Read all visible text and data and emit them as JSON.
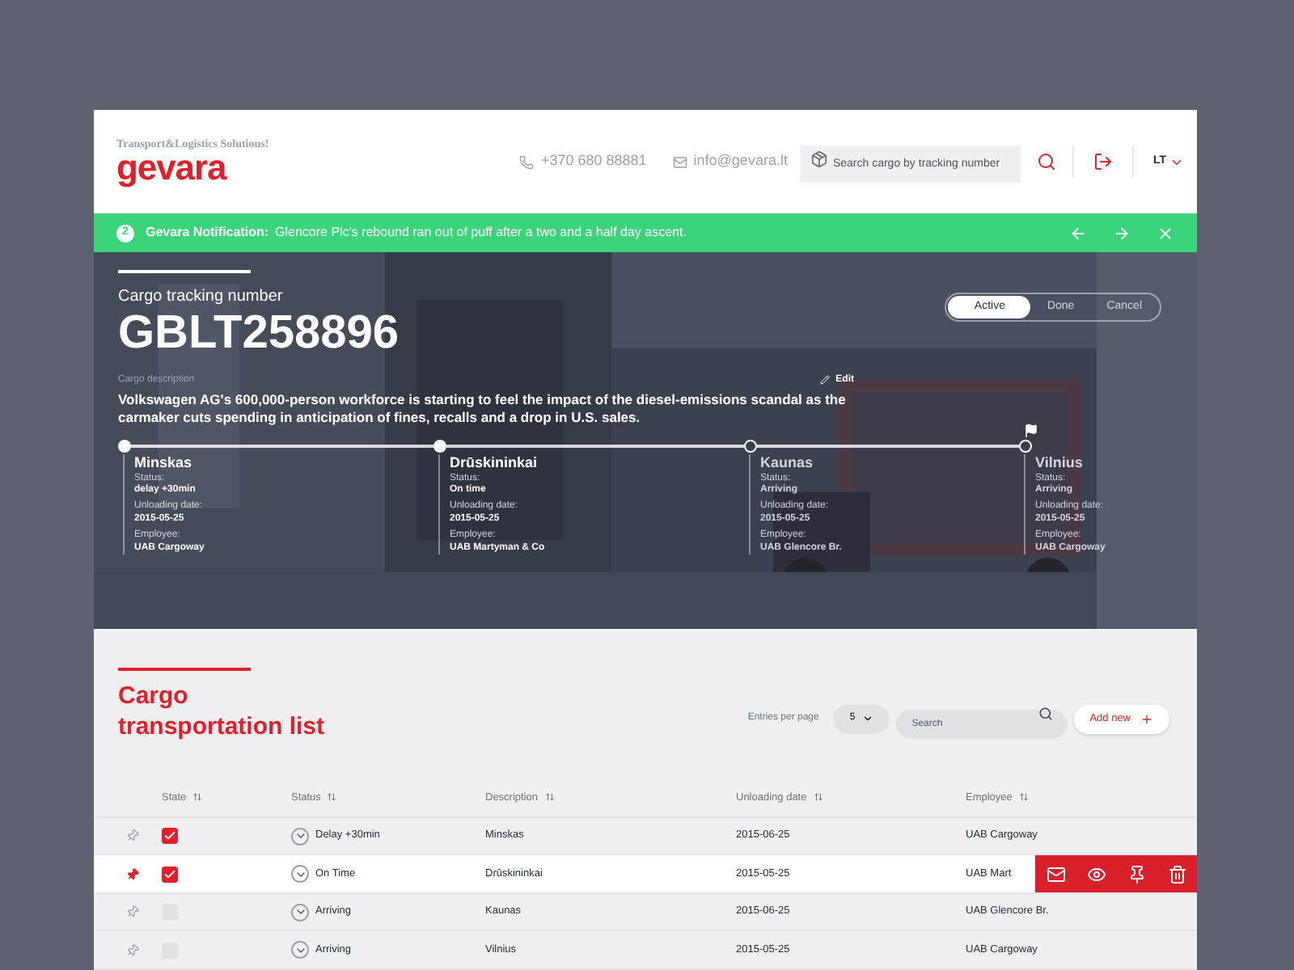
{
  "header": {
    "logo": {
      "tagline": "Transport&Logistics Solutions!",
      "name": "gevara"
    },
    "phone": "+370 680 88881",
    "email": "info@gevara.lt",
    "search": {
      "placeholder": "Search cargo by tracking number"
    },
    "language": "LT"
  },
  "notification": {
    "count": "2",
    "title": "Gevara Notification:",
    "message": "Glencore Plc's rebound ran out of puff after a two and a half day ascent."
  },
  "hero": {
    "label": "Cargo tracking number",
    "tracking_number": "GBLT258896",
    "filters": [
      {
        "label": "Active",
        "selected": true
      },
      {
        "label": "Done",
        "selected": false
      },
      {
        "label": "Cancel",
        "selected": false
      }
    ],
    "description_label": "Cargo description",
    "edit": "Edit",
    "description": "Volkswagen AG's 600,000-person workforce is starting to feel the impact of the diesel-emissions scandal as the carmaker cuts spending in anticipation of fines, recalls and a drop in U.S. sales.",
    "stops": [
      {
        "city": "Minskas",
        "reached": true,
        "flag": false,
        "status_label": "Status:",
        "status": "delay +30min",
        "date_label": "Unloading date:",
        "date": "2015-05-25",
        "employee_label": "Employee:",
        "employee": "UAB Cargoway"
      },
      {
        "city": "Drūskininkai",
        "reached": true,
        "flag": false,
        "status_label": "Status:",
        "status": "On time",
        "date_label": "Unloading date:",
        "date": "2015-05-25",
        "employee_label": "Employee:",
        "employee": "UAB Martyman & Co"
      },
      {
        "city": "Kaunas",
        "reached": false,
        "flag": false,
        "status_label": "Status:",
        "status": "Arriving",
        "date_label": "Unloading date:",
        "date": "2015-05-25",
        "employee_label": "Employee:",
        "employee": "UAB Glencore Br."
      },
      {
        "city": "Vilnius",
        "reached": false,
        "flag": true,
        "status_label": "Status:",
        "status": "Arriving",
        "date_label": "Unloading date:",
        "date": "2015-05-25",
        "employee_label": "Employee:",
        "employee": "UAB Cargoway"
      }
    ]
  },
  "list": {
    "title_line_1": "Cargo",
    "title_line_2": "transportation list",
    "entries_label": "Entries per page",
    "entries_value": "5",
    "search": {
      "placeholder": "Search"
    },
    "add_button": "Add new",
    "columns": [
      "State",
      "Status",
      "Description",
      "Unloading date",
      "Employee"
    ],
    "rows": [
      {
        "pinned": false,
        "checked": true,
        "selected": false,
        "status": "Delay +30min",
        "description": "Minskas",
        "date": "2015-06-25",
        "employee": "UAB Cargoway",
        "actions": false
      },
      {
        "pinned": true,
        "checked": true,
        "selected": true,
        "status": "On Time",
        "description": "Drūskininkai",
        "date": "2015-05-25",
        "employee": "UAB Mart",
        "actions": true
      },
      {
        "pinned": false,
        "checked": false,
        "selected": false,
        "status": "Arriving",
        "description": "Kaunas",
        "date": "2015-06-25",
        "employee": "UAB Glencore Br.",
        "actions": false
      },
      {
        "pinned": false,
        "checked": false,
        "selected": false,
        "status": "Arriving",
        "description": "Vilnius",
        "date": "2015-05-25",
        "employee": "UAB Cargoway",
        "actions": false
      }
    ],
    "row_actions": [
      {
        "kind": "mail"
      },
      {
        "kind": "view"
      },
      {
        "kind": "pin"
      },
      {
        "kind": "delete"
      }
    ]
  }
}
